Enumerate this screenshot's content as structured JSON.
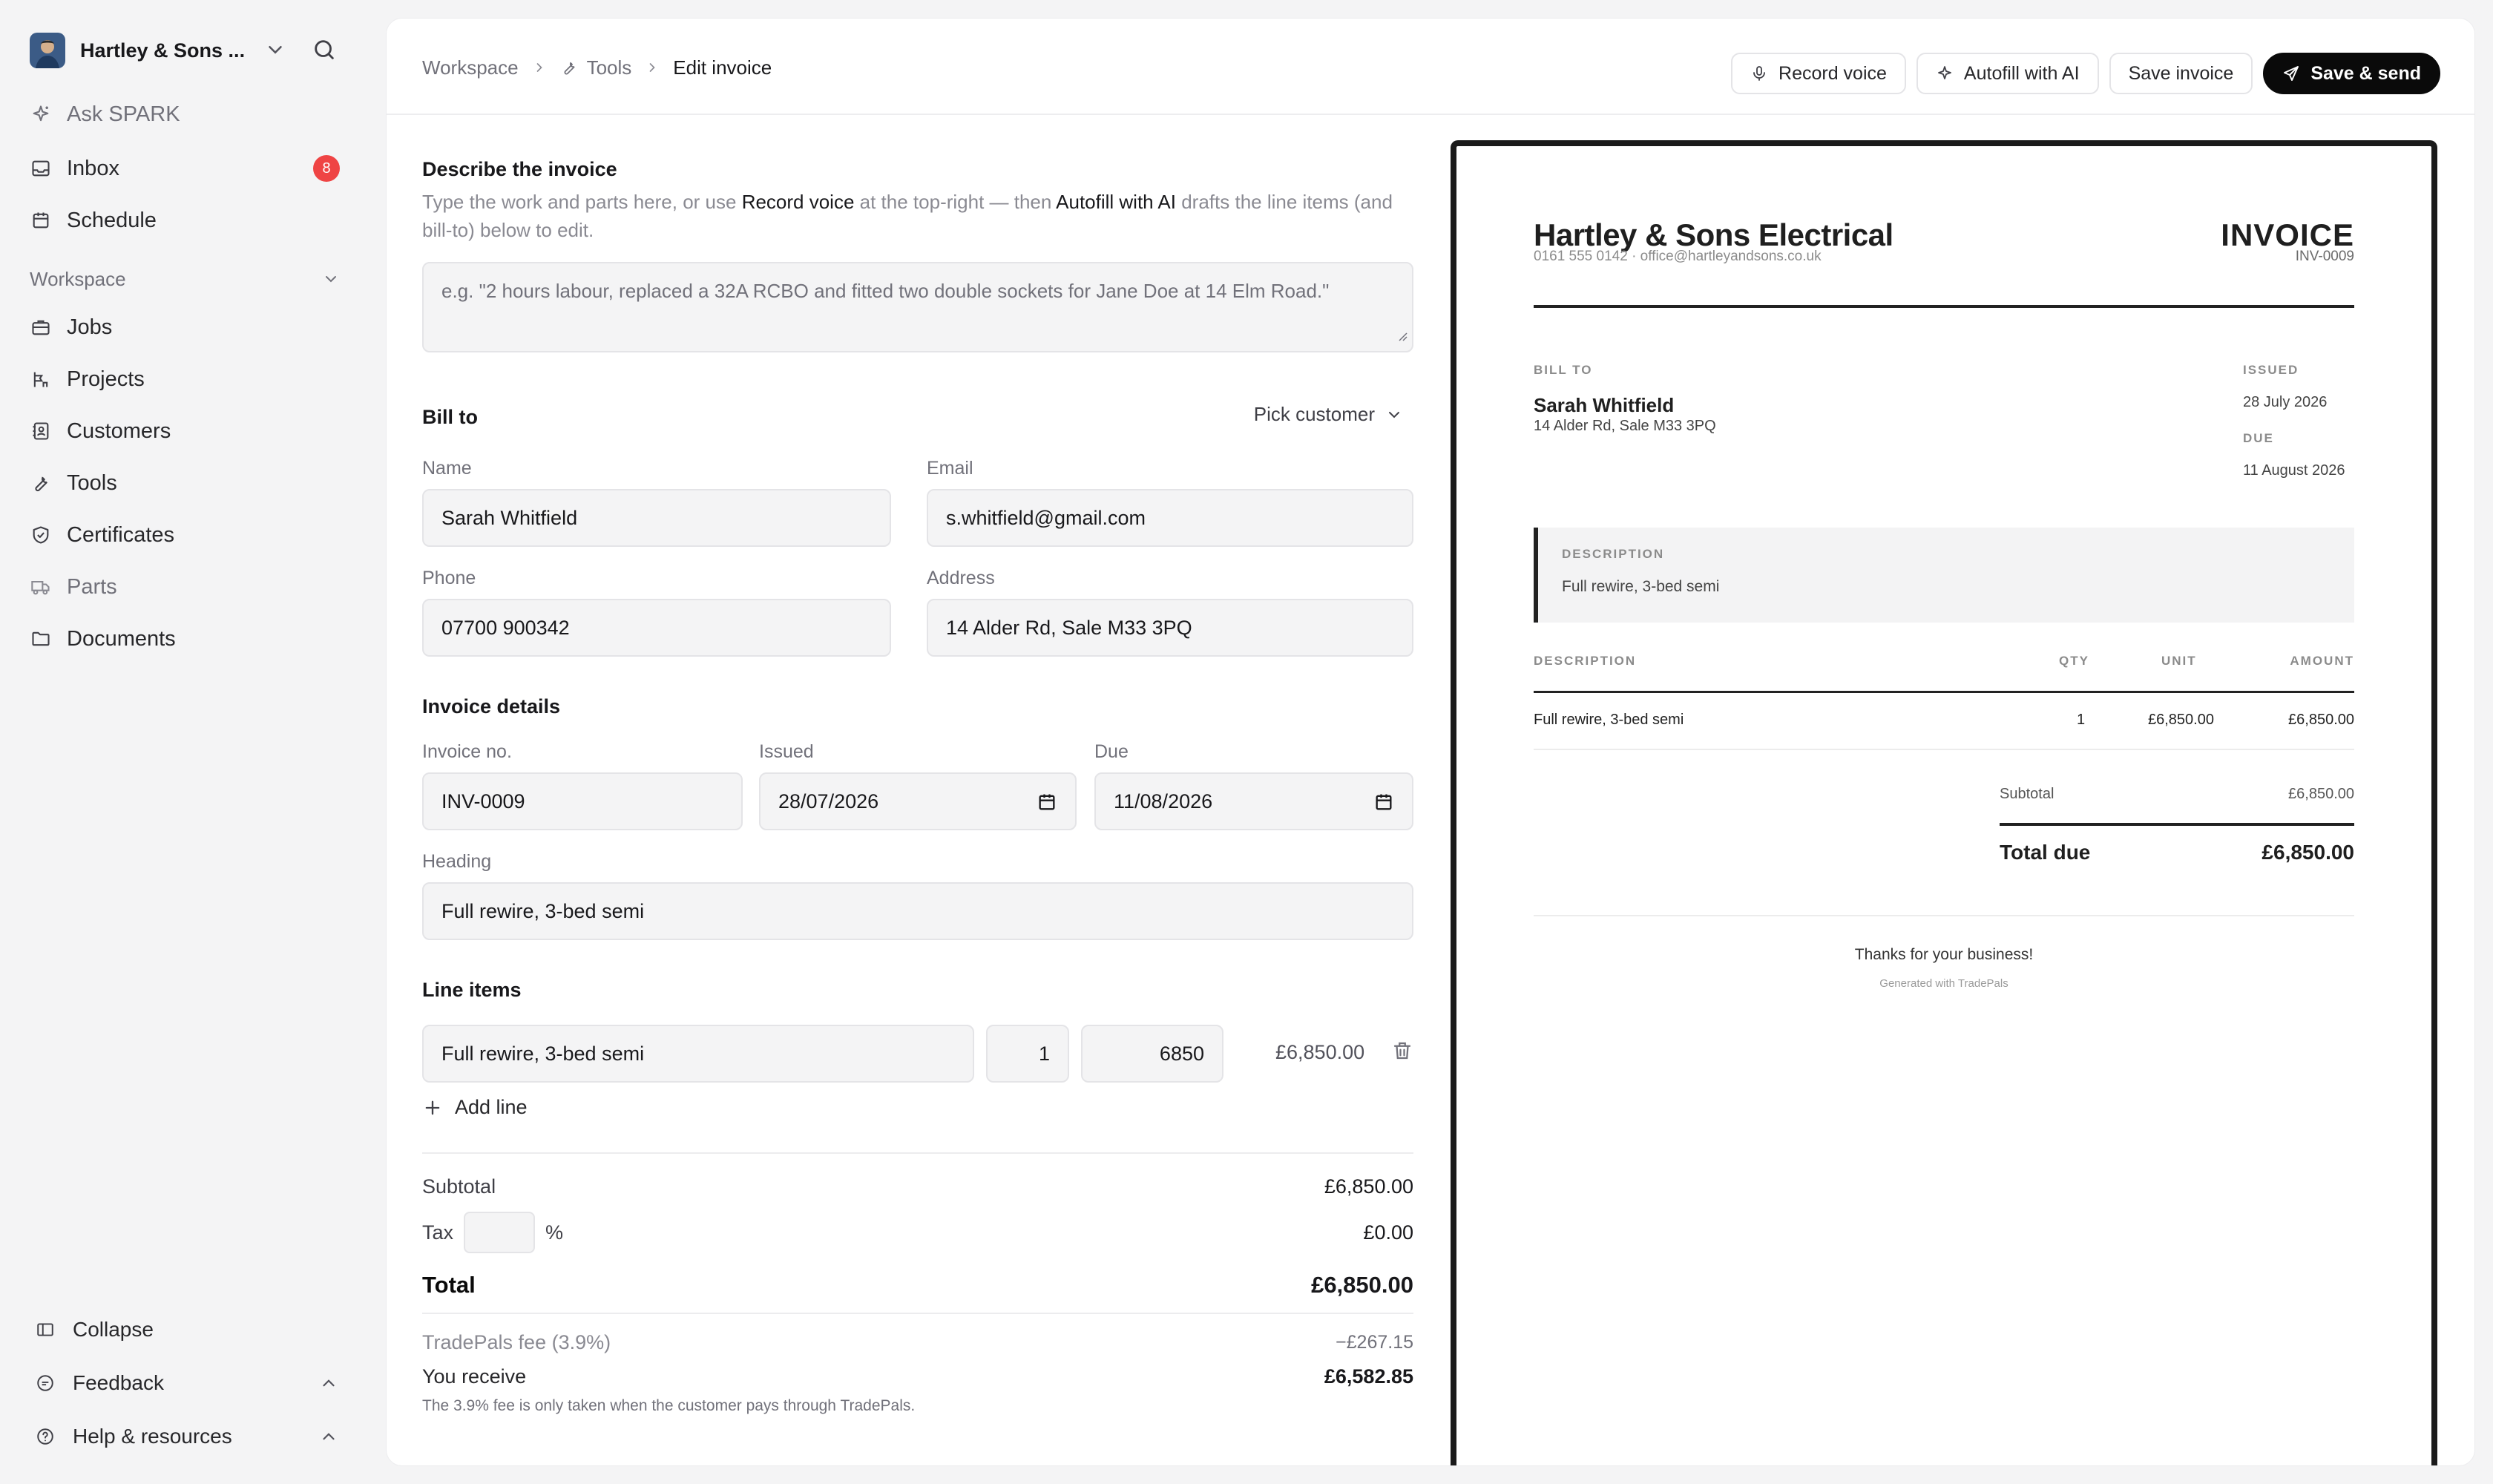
{
  "sidebar": {
    "org_name": "Hartley & Sons ...",
    "nav_top": [
      {
        "label": "Ask SPARK",
        "icon": "sparkle-icon"
      },
      {
        "label": "Inbox",
        "icon": "inbox-icon",
        "badge": "8"
      },
      {
        "label": "Schedule",
        "icon": "calendar-icon"
      }
    ],
    "section_label": "Workspace",
    "nav_workspace": [
      {
        "label": "Jobs",
        "icon": "briefcase-icon"
      },
      {
        "label": "Projects",
        "icon": "projects-icon"
      },
      {
        "label": "Customers",
        "icon": "contacts-icon"
      },
      {
        "label": "Tools",
        "icon": "wrench-icon"
      },
      {
        "label": "Certificates",
        "icon": "shield-check-icon"
      },
      {
        "label": "Parts",
        "icon": "truck-icon"
      },
      {
        "label": "Documents",
        "icon": "folder-icon"
      }
    ],
    "footer": {
      "collapse": "Collapse",
      "feedback": "Feedback",
      "help": "Help & resources"
    }
  },
  "topbar": {
    "breadcrumb": [
      "Workspace",
      "Tools",
      "Edit invoice"
    ],
    "buttons": {
      "record_voice": "Record voice",
      "autofill": "Autofill with AI",
      "save": "Save invoice",
      "save_send": "Save & send"
    }
  },
  "form": {
    "describe": {
      "title": "Describe the invoice",
      "help_1": "Type the work and parts here, or use ",
      "help_link_1": "Record voice",
      "help_2": " at the top-right — then ",
      "help_link_2": "Autofill with AI",
      "help_3": " drafts the line items (and bill-to) below to edit.",
      "placeholder": "e.g. \"2 hours labour, replaced a 32A RCBO and fitted two double sockets for Jane Doe at 14 Elm Road.\""
    },
    "bill_to": {
      "title": "Bill to",
      "pick_customer": "Pick customer",
      "name_label": "Name",
      "name": "Sarah Whitfield",
      "email_label": "Email",
      "email": "s.whitfield@gmail.com",
      "phone_label": "Phone",
      "phone": "07700 900342",
      "address_label": "Address",
      "address": "14 Alder Rd, Sale M33 3PQ"
    },
    "details": {
      "title": "Invoice details",
      "number_label": "Invoice no.",
      "number": "INV-0009",
      "issued_label": "Issued",
      "issued": "28/07/2026",
      "due_label": "Due",
      "due": "11/08/2026",
      "heading_label": "Heading",
      "heading": "Full rewire, 3-bed semi"
    },
    "line_items": {
      "title": "Line items",
      "items": [
        {
          "description": "Full rewire, 3-bed semi",
          "qty": "1",
          "unit": "6850",
          "amount": "£6,850.00"
        }
      ],
      "add_line": "Add line"
    },
    "totals": {
      "subtotal_label": "Subtotal",
      "subtotal": "£6,850.00",
      "tax_label": "Tax",
      "tax_unit": "%",
      "tax": "£0.00",
      "total_label": "Total",
      "total": "£6,850.00",
      "fee_label": "TradePals fee (3.9%)",
      "fee": "−£267.15",
      "receive_label": "You receive",
      "receive": "£6,582.85",
      "note": "The 3.9% fee is only taken when the customer pays through TradePals."
    }
  },
  "preview": {
    "business": "Hartley & Sons Electrical",
    "contact": "0161 555 0142  ·  office@hartleyandsons.co.uk",
    "title": "INVOICE",
    "number": "INV-0009",
    "bill_to_caption": "BILL TO",
    "customer_name": "Sarah Whitfield",
    "customer_address": "14 Alder Rd, Sale M33 3PQ",
    "issued_caption": "ISSUED",
    "issued": "28 July 2026",
    "due_caption": "DUE",
    "due": "11 August 2026",
    "description_caption": "DESCRIPTION",
    "description": "Full rewire, 3-bed semi",
    "table_headers": {
      "description": "DESCRIPTION",
      "qty": "QTY",
      "unit": "UNIT",
      "amount": "AMOUNT"
    },
    "rows": [
      {
        "description": "Full rewire, 3-bed semi",
        "qty": "1",
        "unit": "£6,850.00",
        "amount": "£6,850.00"
      }
    ],
    "subtotal_label": "Subtotal",
    "subtotal": "£6,850.00",
    "total_label": "Total due",
    "total": "£6,850.00",
    "thanks": "Thanks for your business!",
    "generated": "Generated with TradePals"
  }
}
